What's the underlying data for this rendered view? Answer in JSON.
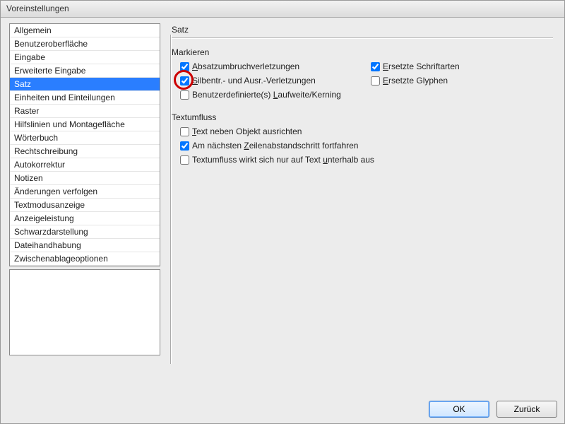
{
  "window": {
    "title": "Voreinstellungen"
  },
  "sidebar": {
    "items": [
      {
        "label": "Allgemein"
      },
      {
        "label": "Benutzeroberfläche"
      },
      {
        "label": "Eingabe"
      },
      {
        "label": "Erweiterte Eingabe"
      },
      {
        "label": "Satz",
        "selected": true
      },
      {
        "label": "Einheiten und Einteilungen"
      },
      {
        "label": "Raster"
      },
      {
        "label": "Hilfslinien und Montagefläche"
      },
      {
        "label": "Wörterbuch"
      },
      {
        "label": "Rechtschreibung"
      },
      {
        "label": "Autokorrektur"
      },
      {
        "label": "Notizen"
      },
      {
        "label": "Änderungen verfolgen"
      },
      {
        "label": "Textmodusanzeige"
      },
      {
        "label": "Anzeigeleistung"
      },
      {
        "label": "Schwarzdarstellung"
      },
      {
        "label": "Dateihandhabung"
      },
      {
        "label": "Zwischenablageoptionen"
      }
    ]
  },
  "panel": {
    "title": "Satz",
    "group_highlight": {
      "legend": "Markieren",
      "opts": [
        {
          "pre": "",
          "m": "A",
          "post": "bsatzumbruchverletzungen",
          "checked": true
        },
        {
          "pre": "",
          "m": "E",
          "post": "rsetzte Schriftarten",
          "checked": true
        },
        {
          "pre": "",
          "m": "S",
          "post": "ilbentr.- und Ausr.-Verletzungen",
          "checked": true,
          "annot": true
        },
        {
          "pre": "",
          "m": "E",
          "post": "rsetzte Glyphen",
          "checked": false
        },
        {
          "pre": "Benutzerdefinierte(s) ",
          "m": "L",
          "post": "aufweite/Kerning",
          "checked": false
        }
      ]
    },
    "group_textwrap": {
      "legend": "Textumfluss",
      "opts": [
        {
          "pre": "",
          "m": "T",
          "post": "ext neben Objekt ausrichten",
          "checked": false
        },
        {
          "pre": "Am nächsten ",
          "m": "Z",
          "post": "eilenabstandschritt fortfahren",
          "checked": true
        },
        {
          "pre": "Textumfluss wirkt sich nur auf Text ",
          "m": "u",
          "post": "nterhalb aus",
          "checked": false
        }
      ]
    }
  },
  "buttons": {
    "ok": "OK",
    "back": "Zurück"
  }
}
